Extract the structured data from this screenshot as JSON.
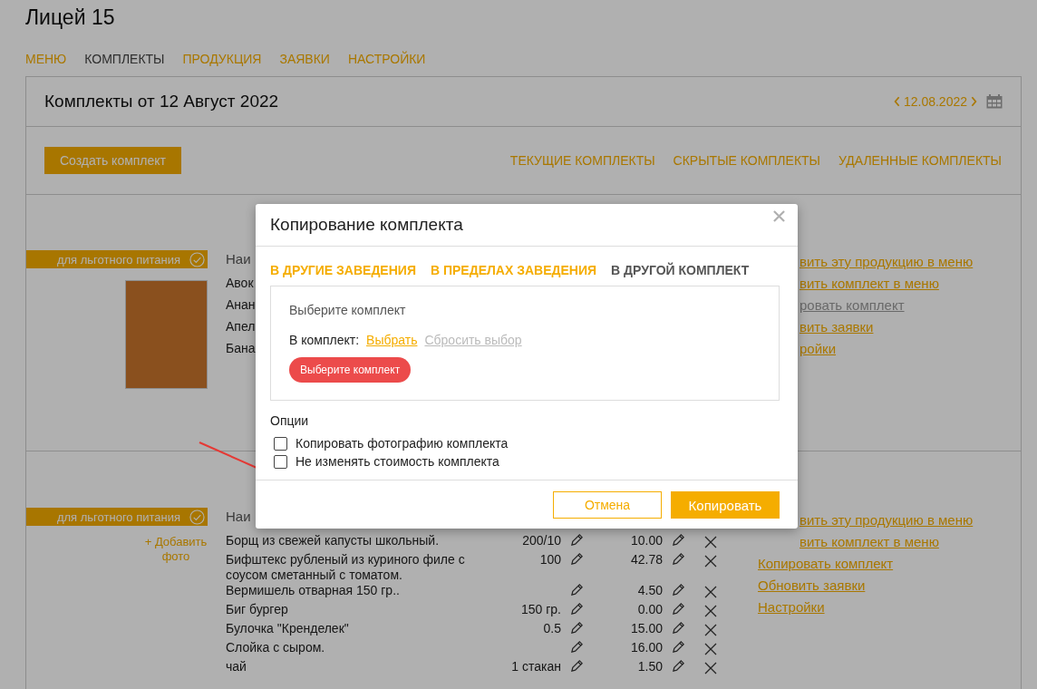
{
  "site_title": "Лицей 15",
  "nav": [
    {
      "label": "МЕНЮ",
      "selected": false
    },
    {
      "label": "КОМПЛЕКТЫ",
      "selected": true
    },
    {
      "label": "ПРОДУКЦИЯ",
      "selected": false
    },
    {
      "label": "ЗАЯВКИ",
      "selected": false
    },
    {
      "label": "НАСТРОЙКИ",
      "selected": false
    }
  ],
  "header": {
    "title": "Комплекты от 12 Август 2022",
    "date": "12.08.2022"
  },
  "create_button": "Создать комплект",
  "filters": [
    "ТЕКУЩИЕ КОМПЛЕКТЫ",
    "СКРЫТЫЕ КОМПЛЕКТЫ",
    "УДАЛЕННЫЕ КОМПЛЕКТЫ"
  ],
  "sets": [
    {
      "tag": "для льготного питания",
      "media": {
        "kind": "photo"
      },
      "name_header": "Наи",
      "items": [
        {
          "name": "Авок"
        },
        {
          "name": "Анан"
        },
        {
          "name": "Апел"
        },
        {
          "name": "Бана"
        }
      ],
      "links": [
        {
          "label": "вить эту продукцию в меню",
          "disabled": false
        },
        {
          "label": "вить комплект в меню",
          "disabled": false
        },
        {
          "label": "ровать комплект",
          "disabled": true
        },
        {
          "label": "вить заявки",
          "disabled": false
        },
        {
          "label": "ройки",
          "disabled": false
        }
      ]
    },
    {
      "tag": "для льготного питания",
      "media": {
        "kind": "add_link",
        "label": "+ Добавить фото"
      },
      "name_header": "Наи",
      "items": [
        {
          "name": "Борщ из свежей капусты школьный.",
          "qty": "200/10",
          "price": "10.00"
        },
        {
          "name": "Бифштекс рубленый из куриного филе с соусом сметанный с томатом.",
          "qty": "100",
          "price": "42.78"
        },
        {
          "name": "Вермишель отварная 150 гр..",
          "price": "4.50"
        },
        {
          "name": "Биг бургер",
          "qty": "150 гр.",
          "price": "0.00"
        },
        {
          "name": "Булочка \"Кренделек\"",
          "qty": "0.5",
          "price": "15.00"
        },
        {
          "name": "Слойка с сыром.",
          "price": "16.00"
        },
        {
          "name": "чай",
          "qty": "1 стакан",
          "price": "1.50"
        }
      ],
      "links": [
        {
          "label": "вить эту продукцию в меню",
          "disabled": false
        },
        {
          "label": "вить комплект в меню",
          "disabled": false
        },
        {
          "label": "Копировать комплект",
          "disabled": false
        },
        {
          "label": "Обновить заявки",
          "disabled": false
        },
        {
          "label": "Настройки",
          "disabled": false
        }
      ]
    }
  ],
  "modal": {
    "title": "Копирование комплекта",
    "tabs": [
      {
        "label": "В ДРУГИЕ ЗАВЕДЕНИЯ",
        "selected": false
      },
      {
        "label": "В ПРЕДЕЛАХ ЗАВЕДЕНИЯ",
        "selected": false
      },
      {
        "label": "В ДРУГОЙ КОМПЛЕКТ",
        "selected": true
      }
    ],
    "box_title": "Выберите комплект",
    "target_label": "В комплект:",
    "choose_link": "Выбрать",
    "reset_link": {
      "label": "Сбросить выбор",
      "disabled": true
    },
    "warning_button": "Выберите комплект",
    "options_title": "Опции",
    "options": [
      {
        "label": "Копировать фотографию комплекта",
        "checked": false
      },
      {
        "label": "Не изменять стоимость комплекта",
        "checked": false
      }
    ],
    "cancel_button": "Отмена",
    "confirm_button": "Копировать"
  }
}
